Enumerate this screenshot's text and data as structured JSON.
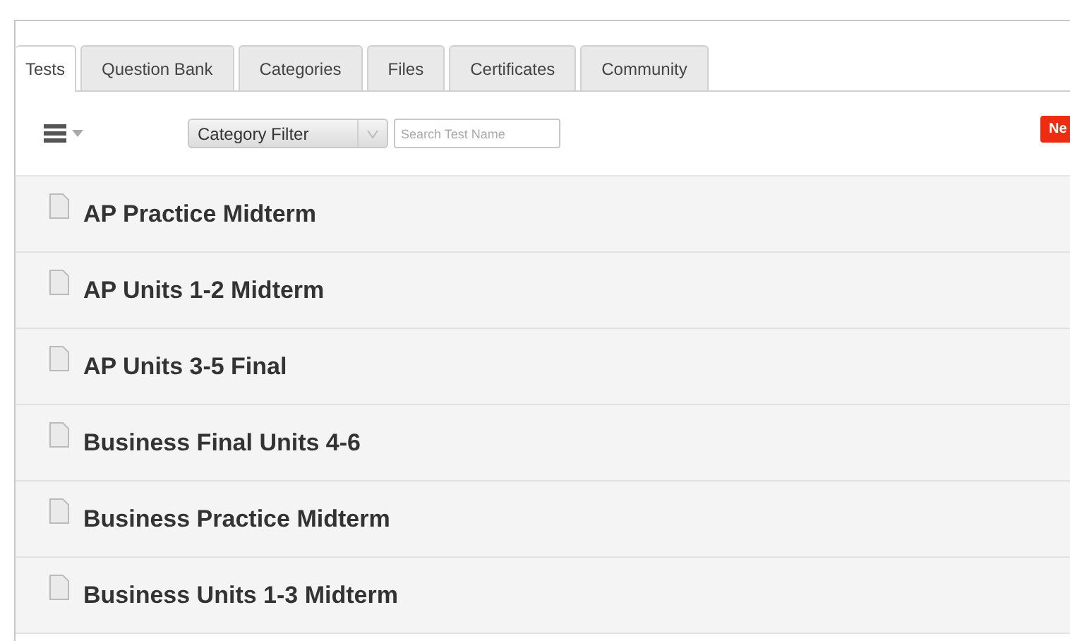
{
  "tabs": [
    {
      "label": "Tests",
      "selected": true
    },
    {
      "label": "Question Bank",
      "selected": false
    },
    {
      "label": "Categories",
      "selected": false
    },
    {
      "label": "Files",
      "selected": false
    },
    {
      "label": "Certificates",
      "selected": false
    },
    {
      "label": "Community",
      "selected": false
    }
  ],
  "toolbar": {
    "category_filter": "Category Filter",
    "search": {
      "placeholder": "Search Test Name"
    },
    "new_button": "Ne"
  },
  "tests": [
    {
      "name": "AP Practice Midterm"
    },
    {
      "name": "AP Units 1-2 Midterm"
    },
    {
      "name": "AP Units 3-5 Final"
    },
    {
      "name": "Business Final Units 4-6"
    },
    {
      "name": "Business Practice Midterm"
    },
    {
      "name": "Business Units 1-3 Midterm"
    }
  ]
}
